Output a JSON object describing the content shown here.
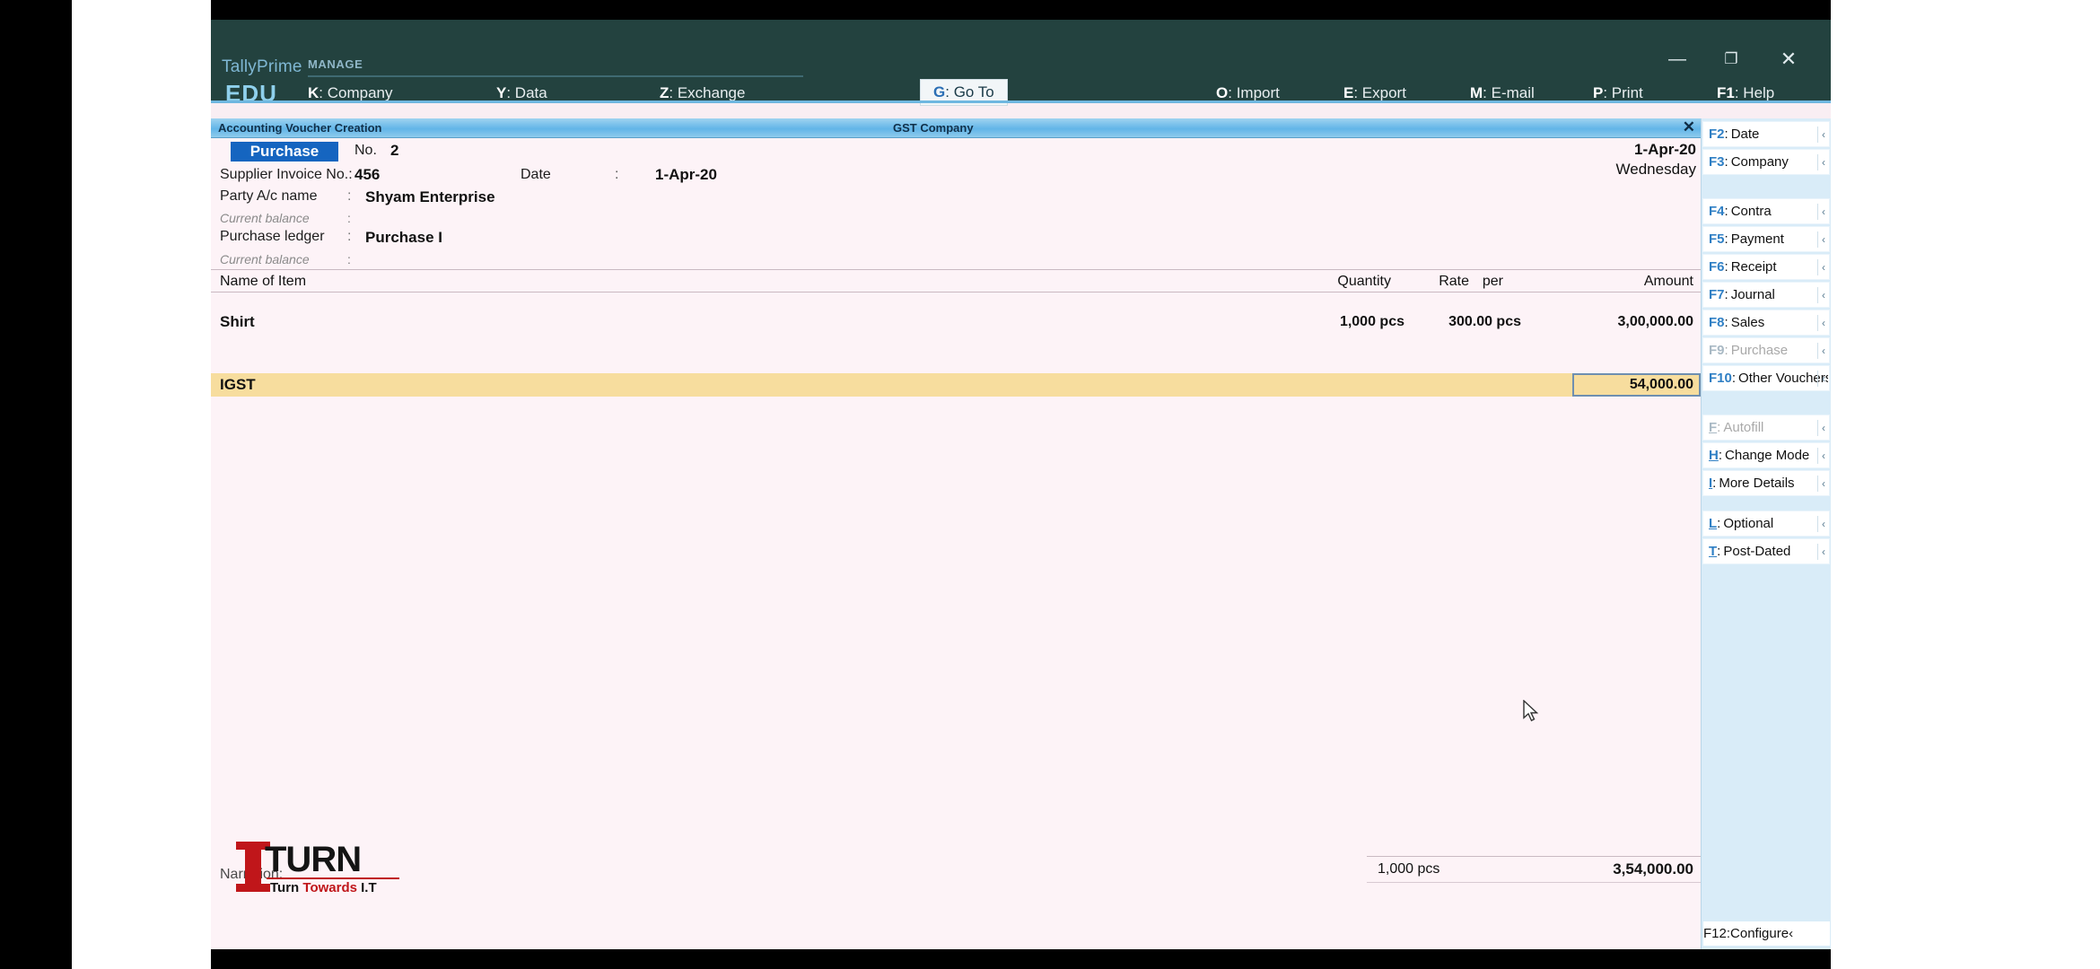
{
  "window": {
    "brand": "TallyPrime",
    "edition": "EDU",
    "section_label": "MANAGE",
    "controls": {
      "minimize": "—",
      "maximize": "❐",
      "close": "✕"
    }
  },
  "menu": [
    {
      "key": "K",
      "label": "Company"
    },
    {
      "key": "Y",
      "label": "Data"
    },
    {
      "key": "Z",
      "label": "Exchange"
    },
    {
      "key": "G",
      "label": "Go To"
    },
    {
      "key": "O",
      "label": "Import"
    },
    {
      "key": "E",
      "label": "Export"
    },
    {
      "key": "M",
      "label": "E-mail"
    },
    {
      "key": "P",
      "label": "Print"
    },
    {
      "key": "F1",
      "label": "Help"
    }
  ],
  "titlebar": {
    "screen_title": "Accounting Voucher Creation",
    "company_name": "GST Company",
    "close": "✕"
  },
  "voucher": {
    "type": "Purchase",
    "number_label": "No.",
    "number_value": "2",
    "supplier_invoice_label": "Supplier Invoice No.:",
    "supplier_invoice_value": "456",
    "date_label": "Date",
    "date_colon": ":",
    "date_value": "1-Apr-20",
    "header_date": "1-Apr-20",
    "header_day": "Wednesday",
    "party_label": "Party A/c name",
    "party_value": "Shyam Enterprise",
    "current_balance_label": "Current balance",
    "current_balance_value": "",
    "ledger_label": "Purchase ledger",
    "ledger_value": "Purchase I",
    "ledger_balance_label": "Current balance",
    "ledger_balance_value": "",
    "colon": ":",
    "narration_label": "Narration:"
  },
  "table": {
    "headers": {
      "name": "Name of Item",
      "quantity": "Quantity",
      "rate": "Rate",
      "per": "per",
      "amount": "Amount"
    },
    "rows": [
      {
        "name": "Shirt",
        "quantity": "1,000 pcs",
        "rate": "300.00",
        "per": "pcs",
        "amount": "3,00,000.00",
        "highlight": false
      }
    ],
    "tax_row": {
      "name": "IGST",
      "amount": "54,000.00",
      "highlight_color": "#f7dd9e"
    },
    "totals": {
      "quantity": "1,000 pcs",
      "amount": "3,54,000.00"
    }
  },
  "logo": {
    "mark": "I",
    "word": "TURN",
    "tagline_1": "Turn ",
    "tagline_2": "Towards ",
    "tagline_3": "I.T"
  },
  "right_panel": {
    "groups": [
      {
        "buttons": [
          {
            "key": "F2",
            "label": "Date",
            "disabled": false,
            "arrow": "‹"
          },
          {
            "key": "F3",
            "label": "Company",
            "disabled": false,
            "arrow": "‹"
          }
        ]
      },
      {
        "buttons": [
          {
            "key": "F4",
            "label": "Contra",
            "disabled": false,
            "arrow": "‹"
          },
          {
            "key": "F5",
            "label": "Payment",
            "disabled": false,
            "arrow": "‹"
          },
          {
            "key": "F6",
            "label": "Receipt",
            "disabled": false,
            "arrow": "‹"
          },
          {
            "key": "F7",
            "label": "Journal",
            "disabled": false,
            "arrow": "‹"
          },
          {
            "key": "F8",
            "label": "Sales",
            "disabled": false,
            "arrow": "‹"
          },
          {
            "key": "F9",
            "label": "Purchase",
            "disabled": true,
            "arrow": "‹"
          },
          {
            "key": "F10",
            "label": "Other Vouchers",
            "disabled": false,
            "arrow": "‹"
          }
        ]
      },
      {
        "buttons": [
          {
            "key": "F",
            "label": "Autofill",
            "disabled": true,
            "arrow": "‹"
          },
          {
            "key": "H",
            "label": "Change Mode",
            "disabled": false,
            "arrow": "‹"
          },
          {
            "key": "I",
            "label": "More Details",
            "disabled": false,
            "arrow": "‹"
          }
        ]
      },
      {
        "buttons": [
          {
            "key": "L",
            "label": "Optional",
            "disabled": false,
            "arrow": "‹"
          },
          {
            "key": "T",
            "label": "Post-Dated",
            "disabled": false,
            "arrow": "‹"
          }
        ]
      }
    ],
    "configure": {
      "key": "F12",
      "label": "Configure",
      "arrow": "‹"
    }
  }
}
